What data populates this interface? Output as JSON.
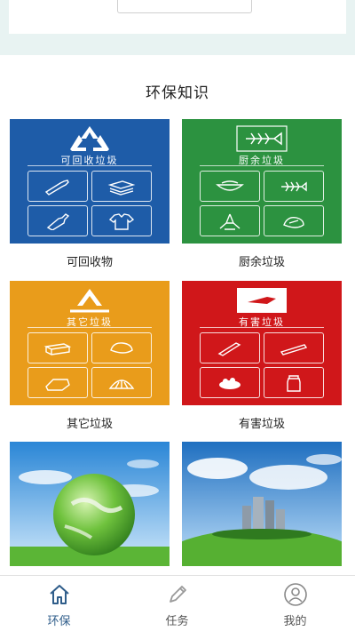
{
  "top": {
    "button_label": ""
  },
  "section": {
    "title": "环保知识"
  },
  "categories": [
    {
      "name": "可回收垃圾",
      "caption": "可回收物",
      "color": "#1e5ca8"
    },
    {
      "name": "厨余垃圾",
      "caption": "厨余垃圾",
      "color": "#2c9240"
    },
    {
      "name": "其它垃圾",
      "caption": "其它垃圾",
      "color": "#e99c1b"
    },
    {
      "name": "有害垃圾",
      "caption": "有害垃圾",
      "color": "#d0171a"
    }
  ],
  "tabs": [
    {
      "label": "环保",
      "icon": "home-icon",
      "active": true
    },
    {
      "label": "任务",
      "icon": "pencil-icon",
      "active": false
    },
    {
      "label": "我的",
      "icon": "user-icon",
      "active": false
    }
  ],
  "colors": {
    "active_tab": "#2f5d8a",
    "inactive_tab": "#999999"
  }
}
